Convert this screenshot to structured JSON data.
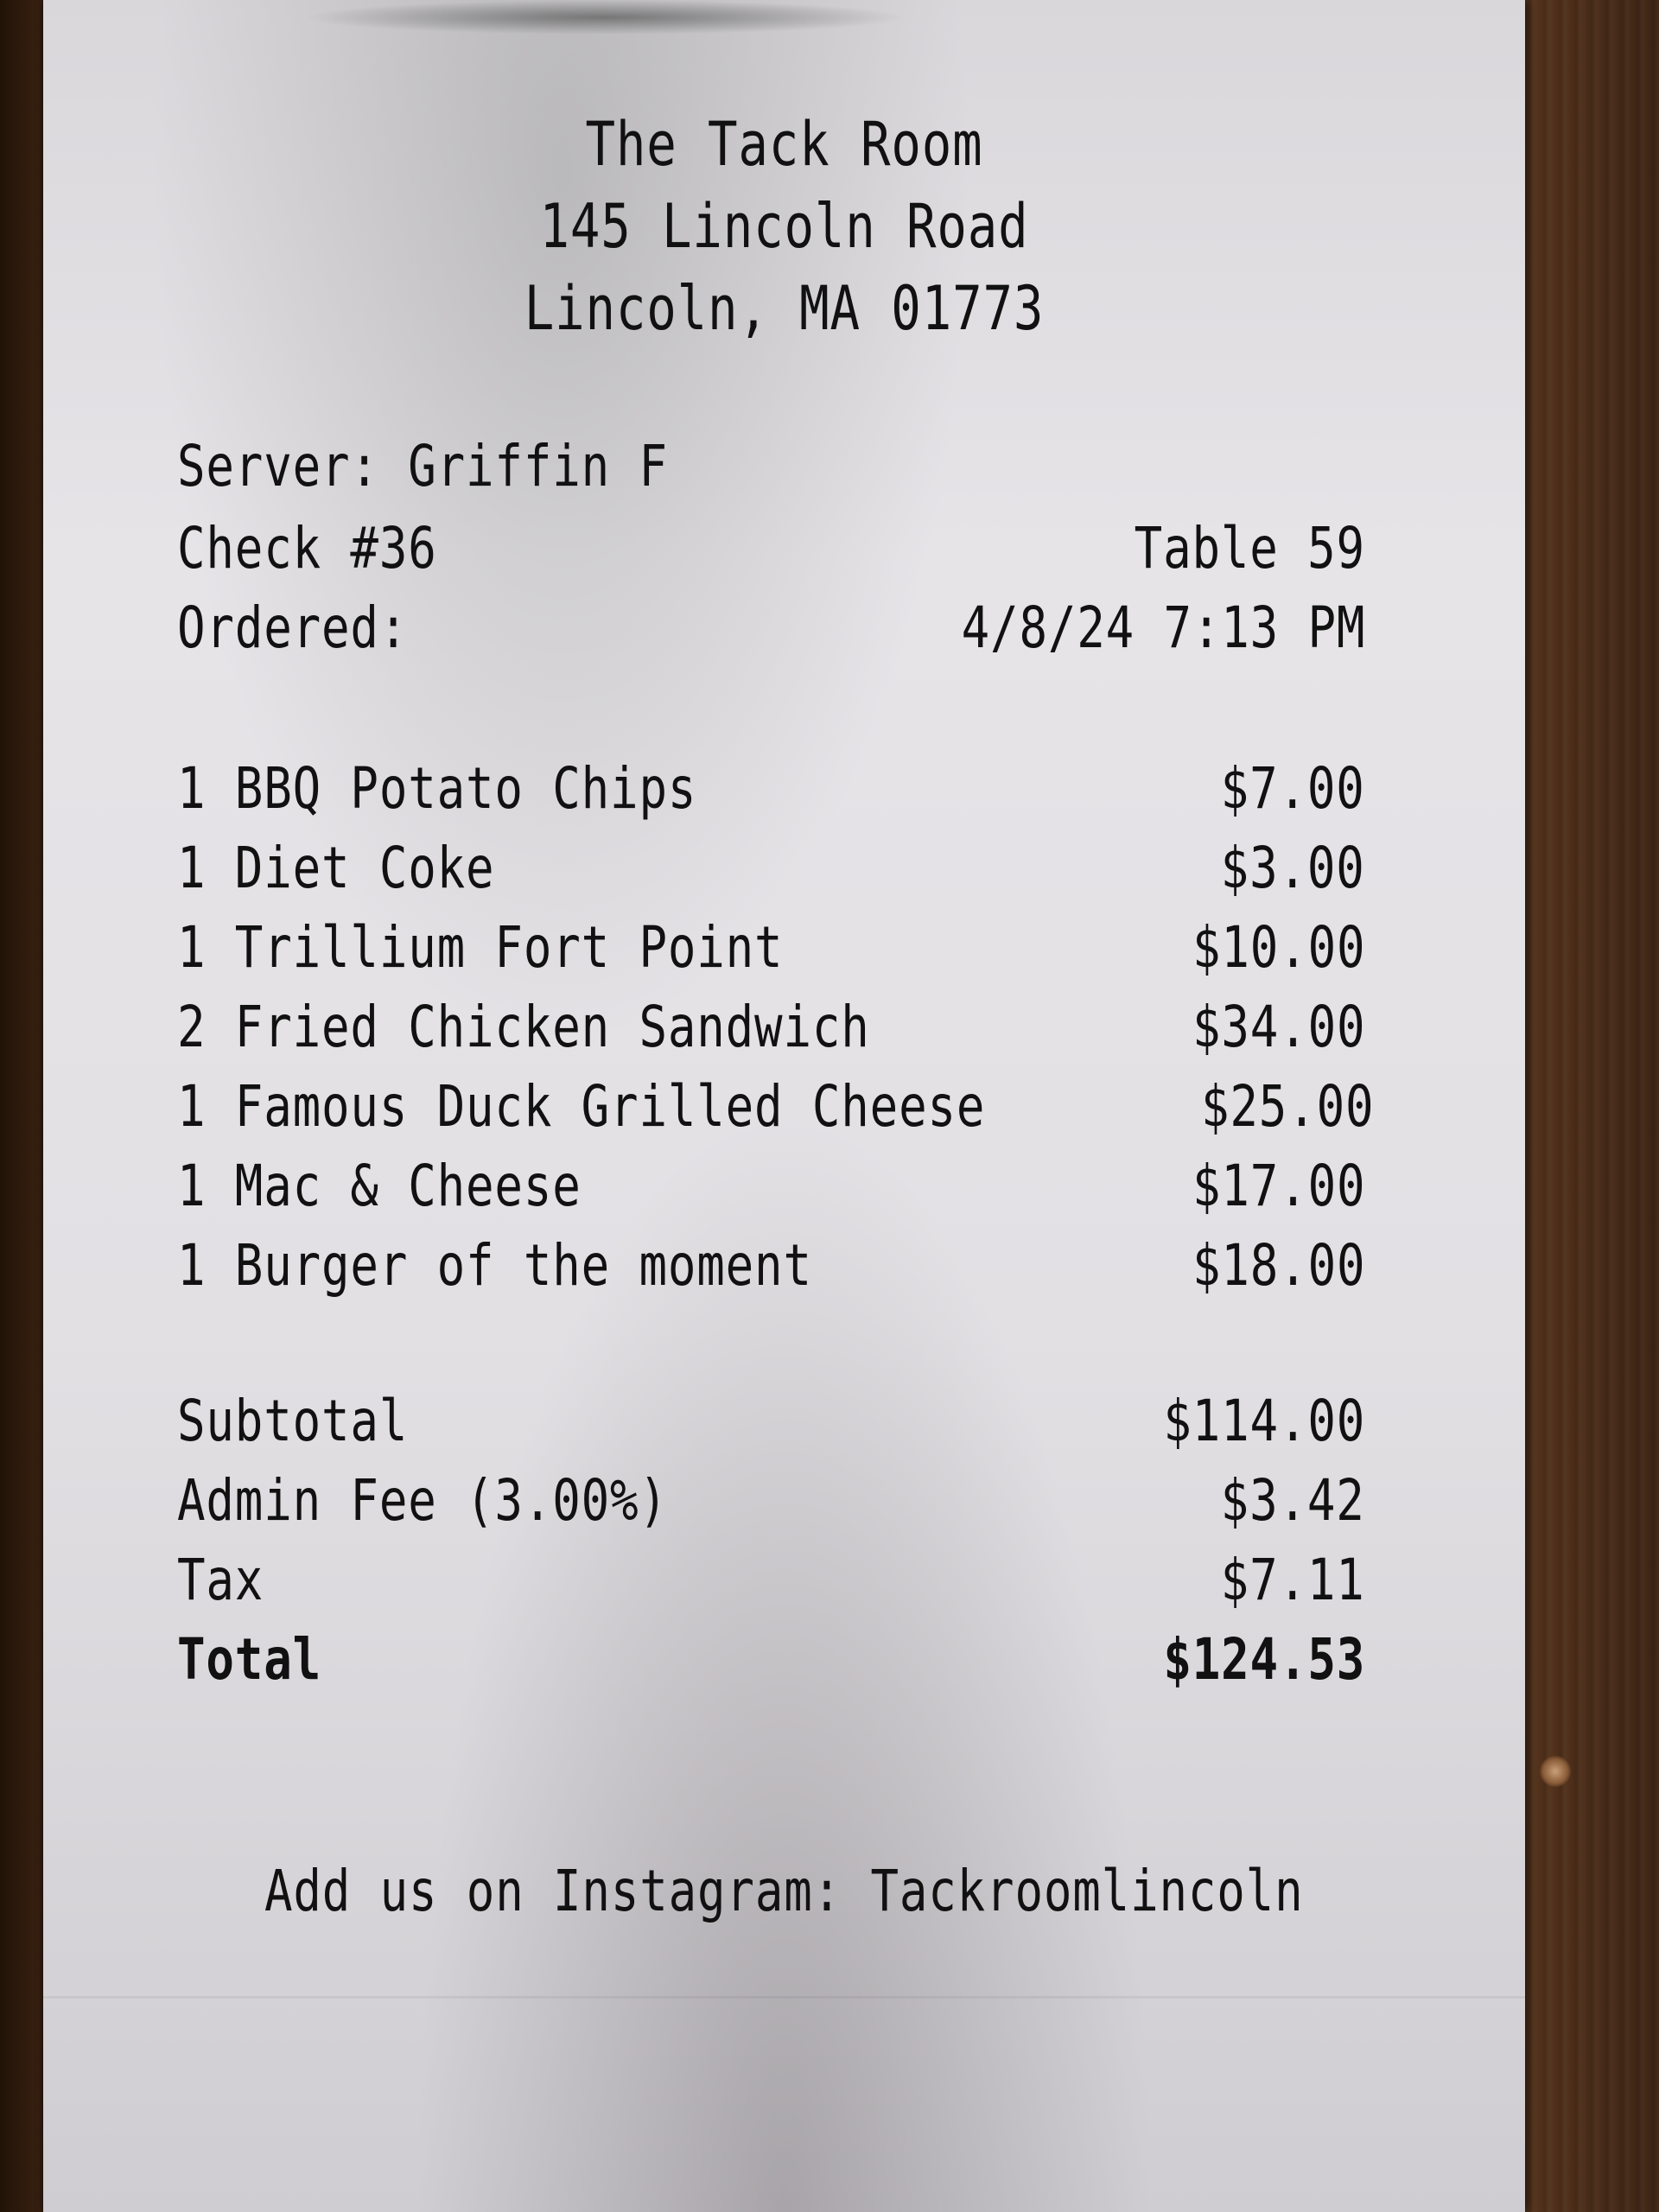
{
  "restaurant": {
    "name": "The Tack Room",
    "address_line1": "145 Lincoln Road",
    "address_line2": "Lincoln, MA 01773"
  },
  "check_info": {
    "server": "Server: Griffin F",
    "check": "Check #36",
    "table": "Table 59",
    "ordered_label": "Ordered:",
    "ordered_datetime": "4/8/24 7:13 PM"
  },
  "items": [
    {
      "label": "1 BBQ Potato Chips",
      "price": "$7.00"
    },
    {
      "label": "1 Diet Coke",
      "price": "$3.00"
    },
    {
      "label": "1 Trillium Fort Point",
      "price": "$10.00"
    },
    {
      "label": "2 Fried Chicken Sandwich",
      "price": "$34.00"
    },
    {
      "label": "1 Famous Duck Grilled Cheese",
      "price": "$25.00"
    },
    {
      "label": "1 Mac & Cheese",
      "price": "$17.00"
    },
    {
      "label": "1 Burger of the moment",
      "price": "$18.00"
    }
  ],
  "totals": {
    "subtotal_label": "Subtotal",
    "subtotal": "$114.00",
    "admin_fee_label": "Admin Fee (3.00%)",
    "admin_fee": "$3.42",
    "tax_label": "Tax",
    "tax": "$7.11",
    "total_label": "Total",
    "total": "$124.53"
  },
  "footer": {
    "instagram": "Add us on Instagram: Tackroomlincoln"
  }
}
